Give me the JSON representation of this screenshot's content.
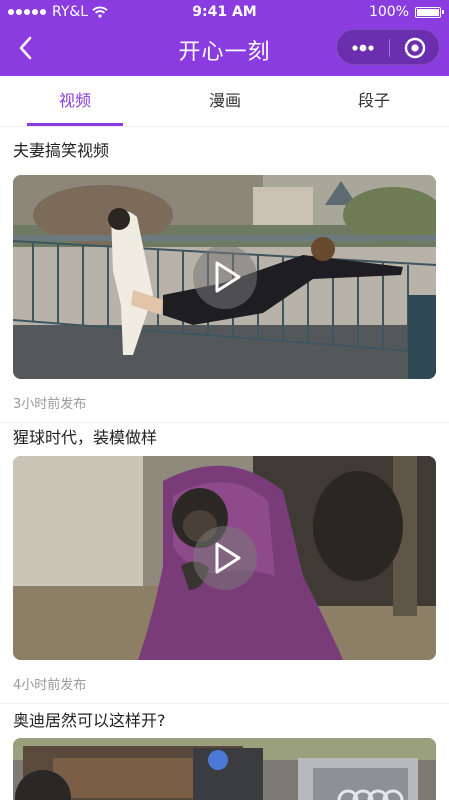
{
  "status_bar": {
    "carrier": "RY&L",
    "time": "9:41 AM",
    "battery": "100%"
  },
  "nav": {
    "title": "开心一刻",
    "back_icon": "chevron-left-icon",
    "more_icon": "more-dots-icon",
    "close_icon": "target-circle-icon"
  },
  "tabs": [
    {
      "label": "视频",
      "active": true
    },
    {
      "label": "漫画",
      "active": false
    },
    {
      "label": "段子",
      "active": false
    }
  ],
  "colors": {
    "brand": "#8a3ce0",
    "meta_text": "#9a9a9a"
  },
  "feed": [
    {
      "title": "夫妻搞笑视频",
      "meta": "3小时前发布",
      "thumbnail": "wedding-couple-railing-photo"
    },
    {
      "title": "猩球时代，装模做样",
      "meta": "4小时前发布",
      "thumbnail": "chimpanzee-purple-blanket-photo"
    },
    {
      "title": "奥迪居然可以这样开?",
      "meta": "",
      "thumbnail": "improvised-audi-vehicle-photo"
    }
  ]
}
